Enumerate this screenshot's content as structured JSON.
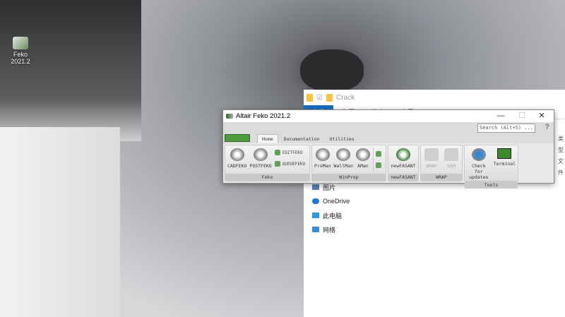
{
  "desktop": {
    "icon_label": "Feko 2021.2"
  },
  "explorer": {
    "path": "Crack",
    "tabs": [
      "文件",
      "主页",
      "共享",
      "查看"
    ],
    "nav": [
      "图片",
      "OneDrive",
      "此电脑",
      "网络"
    ],
    "right": [
      "类型",
      "文件"
    ]
  },
  "feko": {
    "title": "Altair Feko 2021.2",
    "search_placeholder": "Search (Alt+S) ...",
    "help": "?",
    "window_buttons": {
      "minimize": "—",
      "maximize": "☐",
      "close": "✕"
    },
    "tabs": [
      "Home",
      "Documentation",
      "Utilities"
    ],
    "groups": [
      {
        "label": "Feko",
        "tools": [
          "CADFEKO",
          "POSTFEKO"
        ],
        "small": [
          "EDITFEKO",
          "QUEUEFEKO"
        ]
      },
      {
        "label": "WinProp",
        "tools": [
          "ProMan",
          "WallMan",
          "AMan"
        ]
      },
      {
        "label": "newFASANT",
        "tools": [
          "newFASANT"
        ]
      },
      {
        "label": "WRAP",
        "tools": [
          "WRAP",
          "SAM"
        ]
      },
      {
        "label": "Tools",
        "tools": [
          "Check for updates",
          "Terminal"
        ]
      }
    ]
  }
}
